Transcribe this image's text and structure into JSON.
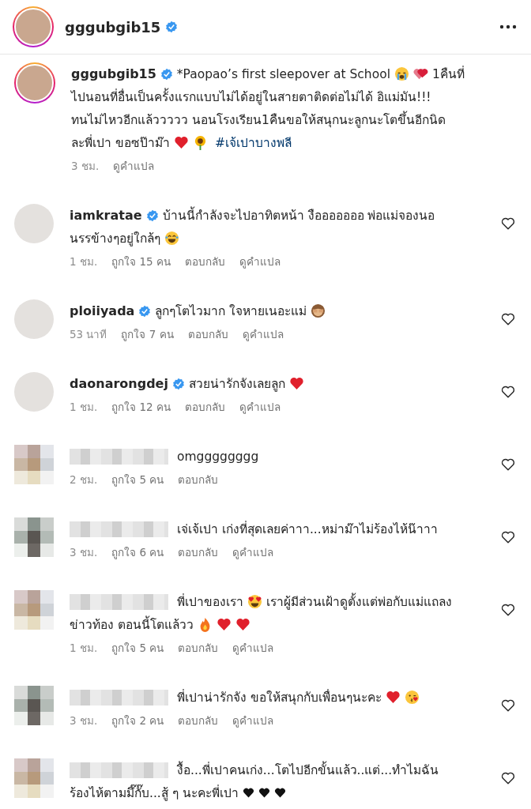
{
  "header": {
    "username": "gggubgib15",
    "verified": true
  },
  "caption": {
    "username": "gggubgib15",
    "verified": true,
    "lines": [
      [
        {
          "kind": "text",
          "text": "*Paopao’s first sleepover at School "
        },
        {
          "kind": "crying-face"
        },
        {
          "kind": "hearts"
        },
        {
          "kind": "text",
          "text": " 1คืนที่"
        }
      ],
      [
        {
          "kind": "text",
          "text": "ไปนอนที่อื่นเป็นครั้งแรกแบบไม่ได้อยู่ในสายตาติดต่อไม่ได้ อิแม่มัน!!!"
        }
      ],
      [
        {
          "kind": "text",
          "text": "ทนไม่ไหวอีกแล้ววววว นอนโรงเรียน1คืนขอให้สนุกนะลูกนะโตขึ้นอีกนิด"
        }
      ],
      [
        {
          "kind": "text",
          "text": "ละพี่เปา ขอซป๊าม๊า"
        },
        {
          "kind": "heart"
        },
        {
          "kind": "sunflower"
        },
        {
          "kind": "link",
          "text": "#เจ้เปาบางพลี"
        }
      ]
    ],
    "time": "3 ชม.",
    "translate": "ดูคำแปล"
  },
  "comments": [
    {
      "blurred": false,
      "username": "iamkratae",
      "verified": true,
      "lines": [
        [
          {
            "kind": "text",
            "text": "บ้านนี้กำลังจะไปอาทิตหน้า งือออออออ พ่อแม่จองนอ"
          }
        ],
        [
          {
            "kind": "text",
            "text": "นรรข้างๆอยู่ใกล้ๆ"
          },
          {
            "kind": "laughing-face"
          }
        ]
      ],
      "time": "1 ชม.",
      "likes": "ถูกใจ 15 คน",
      "reply": "ตอบกลับ",
      "translate": "ดูคำแปล"
    },
    {
      "blurred": false,
      "username": "ploiiyada",
      "verified": true,
      "lines": [
        [
          {
            "kind": "text",
            "text": "ลูกๆโตไวมาก ใจหายเนอะแม่"
          },
          {
            "kind": "monkey-face"
          }
        ]
      ],
      "time": "53 นาที",
      "likes": "ถูกใจ 7 คน",
      "reply": "ตอบกลับ",
      "translate": "ดูคำแปล"
    },
    {
      "blurred": false,
      "username": "daonarongdej",
      "verified": true,
      "lines": [
        [
          {
            "kind": "text",
            "text": "สวยน่ารักจังเลยลูก"
          },
          {
            "kind": "heart"
          }
        ]
      ],
      "time": "1 ชม.",
      "likes": "ถูกใจ 12 คน",
      "reply": "ตอบกลับ",
      "translate": "ดูคำแปล"
    },
    {
      "blurred": true,
      "lines": [
        [
          {
            "kind": "text",
            "text": "omgggggggg"
          }
        ]
      ],
      "time": "2 ชม.",
      "likes": "ถูกใจ 5 คน",
      "reply": "ตอบกลับ"
    },
    {
      "blurred": true,
      "lines": [
        [
          {
            "kind": "text",
            "text": "เจ่เจ้เปา เก่งที่สุดเลยค่าาา...หม่าม๊าไม่ร้องไห้น๊าาา"
          }
        ]
      ],
      "time": "3 ชม.",
      "likes": "ถูกใจ 6 คน",
      "reply": "ตอบกลับ",
      "translate": "ดูคำแปล"
    },
    {
      "blurred": true,
      "lines": [
        [
          {
            "kind": "text",
            "text": "พี่เปาของเรา"
          },
          {
            "kind": "heart-eyes-face"
          },
          {
            "kind": "text",
            "text": "เราผู้มีส่วนเฝ้าดูตั้งแต่พ่อกับแม่แถลง"
          }
        ],
        [
          {
            "kind": "text",
            "text": "ข่าวท้อง ตอนนี้โตแล้วว"
          },
          {
            "kind": "fire"
          },
          {
            "kind": "heart"
          },
          {
            "kind": "heart"
          }
        ]
      ],
      "time": "1 ชม.",
      "likes": "ถูกใจ 5 คน",
      "reply": "ตอบกลับ",
      "translate": "ดูคำแปล"
    },
    {
      "blurred": true,
      "lines": [
        [
          {
            "kind": "text",
            "text": "พี่เปาน่ารักจัง ขอให้สนุกกับเพื่อนๆนะคะ"
          },
          {
            "kind": "heart"
          },
          {
            "kind": "kiss-face"
          }
        ]
      ],
      "time": "3 ชม.",
      "likes": "ถูกใจ 2 คน",
      "reply": "ตอบกลับ",
      "translate": "ดูคำแปล"
    },
    {
      "blurred": true,
      "lines": [
        [
          {
            "kind": "text",
            "text": "งื้อ...พี่เปาคนเก่ง...โตไปอีกขั้นแล้ว..แต่...ทำไมฉัน"
          }
        ],
        [
          {
            "kind": "text",
            "text": "ร้องไห้ตามมึ๊กั๊บ...สู้ ๆ นะคะพี่เปา"
          },
          {
            "kind": "black-heart"
          },
          {
            "kind": "black-heart"
          },
          {
            "kind": "black-heart"
          }
        ]
      ]
    }
  ]
}
